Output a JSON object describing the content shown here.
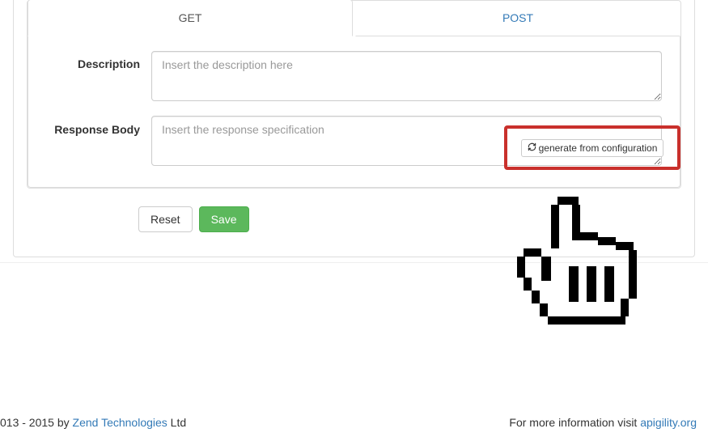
{
  "tabs": {
    "get": "GET",
    "post": "POST"
  },
  "form": {
    "description_label": "Description",
    "description_placeholder": "Insert the description here",
    "description_value": "",
    "responsebody_label": "Response Body",
    "responsebody_placeholder": "Insert the response specification",
    "responsebody_value": "",
    "generate_label": "generate from configuration"
  },
  "buttons": {
    "reset": "Reset",
    "save": "Save"
  },
  "footer": {
    "left_prefix": "013 - 2015 by ",
    "left_link": "Zend Technologies",
    "left_suffix": " Ltd",
    "right_prefix": "For more information visit ",
    "right_link": "apigility.org"
  }
}
